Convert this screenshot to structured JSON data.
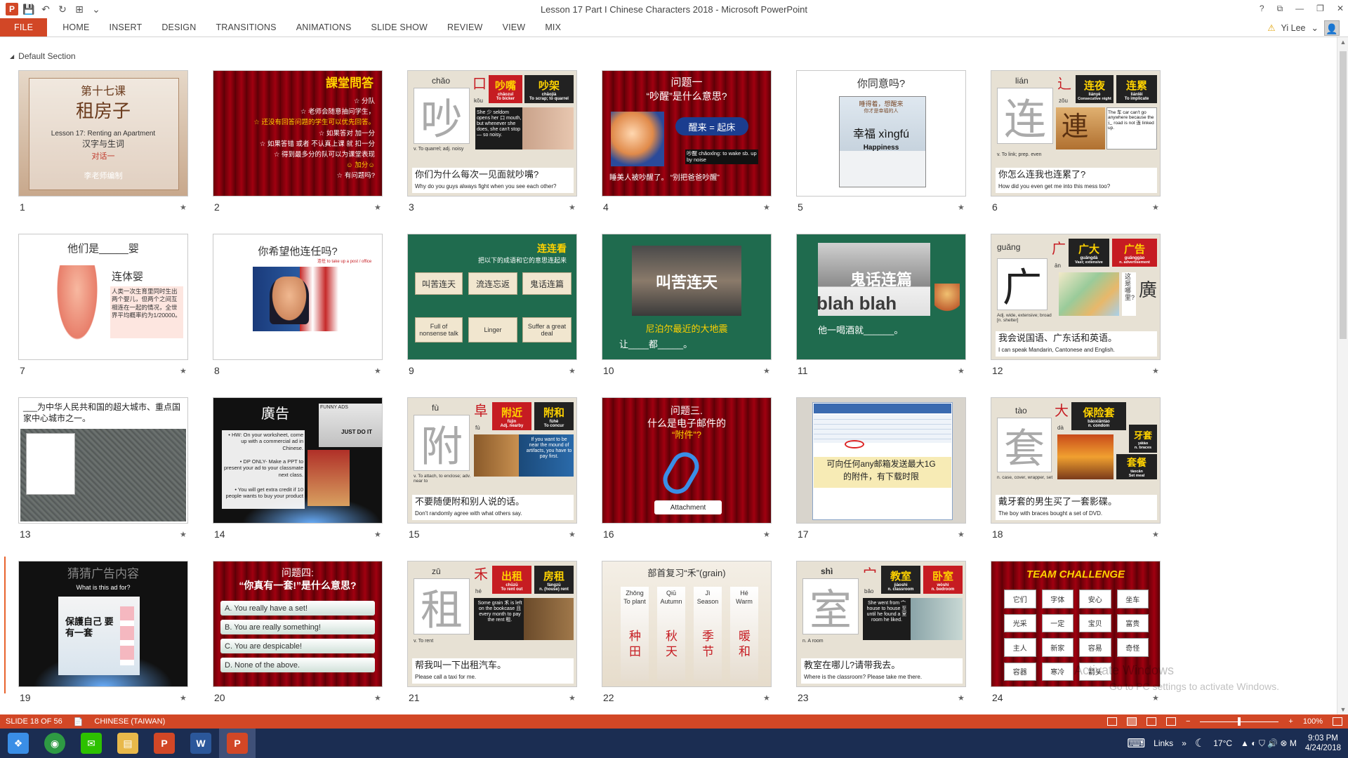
{
  "window": {
    "title": "Lesson 17 Part I Chinese Characters 2018 - Microsoft PowerPoint",
    "help": "?",
    "restore": "⧉",
    "minimize": "—",
    "maximize": "❐",
    "close": "✕"
  },
  "qat": {
    "app_icon": "P",
    "save_icon": "💾",
    "undo_icon": "↶",
    "redo_icon": "↻",
    "present_icon": "⊞",
    "more_icon": "⌄"
  },
  "ribbon": {
    "tabs": [
      "FILE",
      "HOME",
      "INSERT",
      "DESIGN",
      "TRANSITIONS",
      "ANIMATIONS",
      "SLIDE SHOW",
      "REVIEW",
      "VIEW",
      "MIX"
    ]
  },
  "user": {
    "warning_icon": "⚠",
    "name": "Yi Lee",
    "chevron": "⌄"
  },
  "section": {
    "caret": "◢",
    "label": "Default Section"
  },
  "slide_numbers": [
    "1",
    "2",
    "3",
    "4",
    "5",
    "6",
    "7",
    "8",
    "9",
    "10",
    "11",
    "12",
    "13",
    "14",
    "15",
    "16",
    "17",
    "18",
    "19",
    "20",
    "21",
    "22",
    "23",
    "24"
  ],
  "star_icon": "★",
  "slides": {
    "s1": {
      "l1": "第十七课",
      "l2": "租房子",
      "l3": "Lesson 17: Renting an Apartment",
      "l4": "汉字与生词",
      "l5": "对话一",
      "l6": "李老师编制"
    },
    "s2": {
      "title": "課堂問答",
      "lines": [
        "☆ 分队",
        "☆ 老师会随意抽问学生，",
        "☆ 还没有回答问题的学生可以优先回答。",
        "☆ 如果答对 加一分",
        "☆ 如果答错 或者 不认真上课 就 扣一分",
        "☆ 得到最多分的队可以为课堂表现",
        "☺ 加分☺",
        "☆ 有问题吗?"
      ]
    },
    "s3": {
      "pinyin": "chǎo",
      "char": "吵",
      "radical": "口",
      "radical_py": "kǒu",
      "w1": "吵嘴",
      "w1_py": "chǎozuǐ",
      "w1_en": "To bicker",
      "w2": "吵架",
      "w2_py": "chǎojià",
      "w2_en": "To scrap; to quarrel",
      "story": "She 少 seldom opens her 口 mouth, but whenever she does, she can't stop — so noisy.",
      "def": "v. To quarrel; adj. noisy",
      "sent": "你们为什么每次一见面就吵嘴?",
      "eng": "Why do you guys always fight when you see each other?"
    },
    "s4": {
      "title": "问题一",
      "sub": "“吵醒”是什么意思?",
      "pill": "醒来 = 起床",
      "note": "吵醒 chǎoxǐng: to wake sb. up by noise",
      "bottom": "睡美人被吵醒了。 “别把爸爸吵醒”"
    },
    "s5": {
      "title": "你同意吗?",
      "cap1": "睡得着，想醒来",
      "cap2": "你才是幸福的人",
      "main": "幸福 xìngfú",
      "eng": "Happiness"
    },
    "s6": {
      "pinyin": "lián",
      "char": "连",
      "radical": "辶",
      "radical_py": "zǒu",
      "w1": "连夜",
      "w1_py": "liányè",
      "w1_en": "Consecutive night",
      "w2": "连累",
      "w2_py": "liánlěi",
      "w2_en": "To implicate",
      "story": "The 车 car can't go anywhere because the 辶 road is not 连 linked up.",
      "big": "連",
      "def": "v. To link; prep. even",
      "sent": "你怎么连我也连累了?",
      "eng": "How did you even get me into this mess too?"
    },
    "s7": {
      "title": "他们是_____婴",
      "word": "连体婴",
      "text": "人类一次生育里同时生出两个婴儿，但两个之间互相连在一起的情况，全世界平均概率约为1/20000。"
    },
    "s8": {
      "title": "你希望他连任吗?",
      "note": "连任 to take up a post / office"
    },
    "s9": {
      "title": "连连看",
      "sub": "把以下的成语和它的意思连起来",
      "c1": "叫苦连天",
      "c2": "流连忘返",
      "c3": "鬼话连篇",
      "e1": "Full of nonsense talk",
      "e2": "Linger",
      "e3": "Suffer a great deal"
    },
    "s10": {
      "banner": "叫苦连天",
      "l1": "尼泊尔最近的大地震",
      "l2": "让____都_____。"
    },
    "s11": {
      "banner": "鬼话连篇",
      "bg": "blah blah",
      "l1": "他一喝酒就______。"
    },
    "s12": {
      "pinyin": "guǎng",
      "char": "广",
      "radical": "广",
      "radical_py": "ān",
      "w1": "广大",
      "w1_py": "guǎngdà",
      "w1_en": "Vast; extensive",
      "w2": "广告",
      "w2_py": "guǎnggào",
      "w2_en": "n. advertisement",
      "trad": "廣",
      "vert": "这是哪里?",
      "def": "Adj. wide, extensive; broad [n. shelter]",
      "sent": "我会说国语、广东话和英语。",
      "eng": "I can speak Mandarin, Cantonese and English."
    },
    "s13": {
      "title": "___为中华人民共和国的超大城市、重点国家中心城市之一。"
    },
    "s14": {
      "title": "廣告",
      "tag1": "FUNNY ADS",
      "tag2": "JUST DO IT",
      "b1": "• HW: On your worksheet, come up with a commercial ad in Chinese.",
      "b2": "• DP ONLY- Make a PPT to present your ad to your classmate next class.",
      "b3": "• You will get extra credit if 10 people wants to buy your product"
    },
    "s15": {
      "pinyin": "fù",
      "char": "附",
      "radical": "阜",
      "radical_py": "fù",
      "w1": "附近",
      "w1_py": "fùjìn",
      "w1_en": "Adj. nearby",
      "w2": "附和",
      "w2_py": "fùhè",
      "w2_en": "To concur",
      "story": "If you want to be near the mound of artifacts, you have to pay first.",
      "def": "v. To attach, to enclose; adv. near to",
      "sent": "不要随便附和别人说的话。",
      "eng": "Don't randomly agree with what others say."
    },
    "s16": {
      "title": "问题三.",
      "sub": "什么是电子邮件的",
      "q": "“附件”?",
      "label": "Attachment"
    },
    "s17": {
      "l1": "可向任何any邮箱发送最大1G",
      "l2": "的附件，有下载时限"
    },
    "s18": {
      "pinyin": "tào",
      "char": "套",
      "radical": "大",
      "radical_py": "dà",
      "w1": "保险套",
      "w1_py": "bǎoxiǎntào",
      "w1_en": "n. condom",
      "w2": "牙套",
      "w2_py": "yátào",
      "w2_en": "n. braces",
      "w3": "套餐",
      "w3_py": "tàocān",
      "w3_en": "Set meal",
      "def": "n. case, cover, wrapper, set",
      "sent": "戴牙套的男生买了一套影碟。",
      "eng": "The boy with braces bought a set of DVD."
    },
    "s19": {
      "title": "猜猜广告内容",
      "sub": "What is this ad for?",
      "ad": "保護自己 要有一套"
    },
    "s20": {
      "title": "问题四:",
      "sub": "“你真有一套!”是什么意思?",
      "a": "A. You really have a set!",
      "b": "B. You are really something!",
      "c": "C. You are despicable!",
      "d": "D. None of the above."
    },
    "s21": {
      "pinyin": "zū",
      "char": "租",
      "radical": "禾",
      "radical_py": "hé",
      "w1": "出租",
      "w1_py": "chūzū",
      "w1_en": "To rent out",
      "w2": "房租",
      "w2_py": "fángzū",
      "w2_en": "n. (house) rent",
      "story": "Some grain 禾 is left on the bookcase 且 every month to pay the rent 租.",
      "def": "v. To rent",
      "sent": "帮我叫一下出租汽车。",
      "eng": "Please call a taxi for me."
    },
    "s22": {
      "title": "部首复习“禾”(grain)",
      "cols": [
        {
          "py": "Zhǒng",
          "en": "To plant",
          "w": "种田"
        },
        {
          "py": "Qiū",
          "en": "Autumn",
          "w": "秋天"
        },
        {
          "py": "Jì",
          "en": "Season",
          "w": "季节"
        },
        {
          "py": "Hé",
          "en": "Warm",
          "w": "暖和"
        }
      ]
    },
    "s23": {
      "pinyin": "shì",
      "char": "室",
      "radical": "宀",
      "radical_py": "bǎo",
      "w1": "教室",
      "w1_py": "jiàoshì",
      "w1_en": "n. classroom",
      "w2": "卧室",
      "w2_py": "wòshì",
      "w2_en": "n. bedroom",
      "story": "She went from 宀 house to house 至 until he found a 室 room he liked.",
      "def": "n. A room",
      "sent": "教室在哪儿?请带我去。",
      "eng": "Where is the classroom? Please take me there."
    },
    "s24": {
      "title": "TEAM CHALLENGE",
      "grid": [
        "它们",
        "字体",
        "安心",
        "坐车",
        "光采",
        "一定",
        "宝贝",
        "富贵",
        "主人",
        "新家",
        "容易",
        "奇怪",
        "容器",
        "寒冷",
        "箭头"
      ]
    }
  },
  "watermark": {
    "l1": "Activate Windows",
    "l2": "Go to PC settings to activate Windows."
  },
  "status": {
    "slide_info": "SLIDE 18 OF 56",
    "notes_icon": "📄",
    "language": "CHINESE (TAIWAN)",
    "zoom": "100%",
    "zoom_minus": "−",
    "zoom_plus": "+",
    "zoom_level": 1.0
  },
  "taskbar": {
    "apps": [
      {
        "name": "start",
        "label": "❖",
        "color": "#3a8ee6"
      },
      {
        "name": "chrome",
        "label": "◉",
        "color": "#2e9a43"
      },
      {
        "name": "wechat",
        "label": "✉",
        "color": "#2dc100"
      },
      {
        "name": "explorer",
        "label": "▤",
        "color": "#e8b84a"
      },
      {
        "name": "powerpoint-1",
        "label": "P",
        "color": "#d24726"
      },
      {
        "name": "word",
        "label": "W",
        "color": "#2b579a"
      },
      {
        "name": "powerpoint-2",
        "label": "P",
        "color": "#d24726"
      }
    ],
    "links": "Links",
    "weather": "17°C",
    "time": "9:03 PM",
    "date": "4/24/2018",
    "keyboard_icon": "⌨",
    "chevron": "»",
    "moon_icon": "☾"
  }
}
